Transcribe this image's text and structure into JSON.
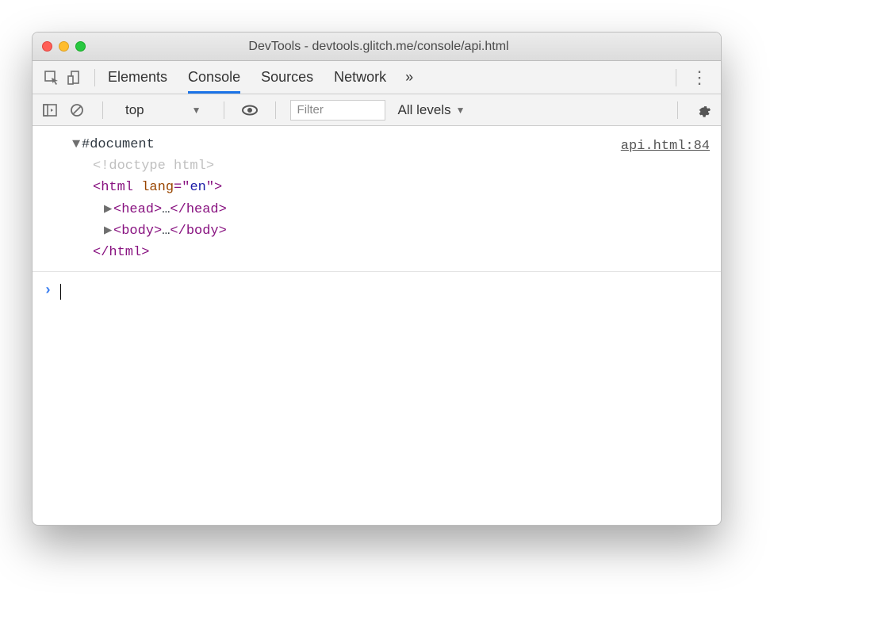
{
  "title": "DevTools - devtools.glitch.me/console/api.html",
  "tabs": {
    "elements": "Elements",
    "console": "Console",
    "sources": "Sources",
    "network": "Network"
  },
  "toolbar": {
    "context": "top",
    "filter_placeholder": "Filter",
    "levels": "All levels"
  },
  "source_link": "api.html:84",
  "dom": {
    "root": "#document",
    "doctype": "<!doctype html>",
    "html_open_tag": "html",
    "html_open_sp": " ",
    "html_attr_name": "lang",
    "html_attr_eq": "=\"",
    "html_attr_val": "en",
    "html_attr_close": "\">",
    "head_open": "<head>",
    "head_close": "</head>",
    "body_open": "<body>",
    "body_close": "</body>",
    "html_close": "</html>",
    "ellipsis": "…",
    "lt": "<"
  }
}
